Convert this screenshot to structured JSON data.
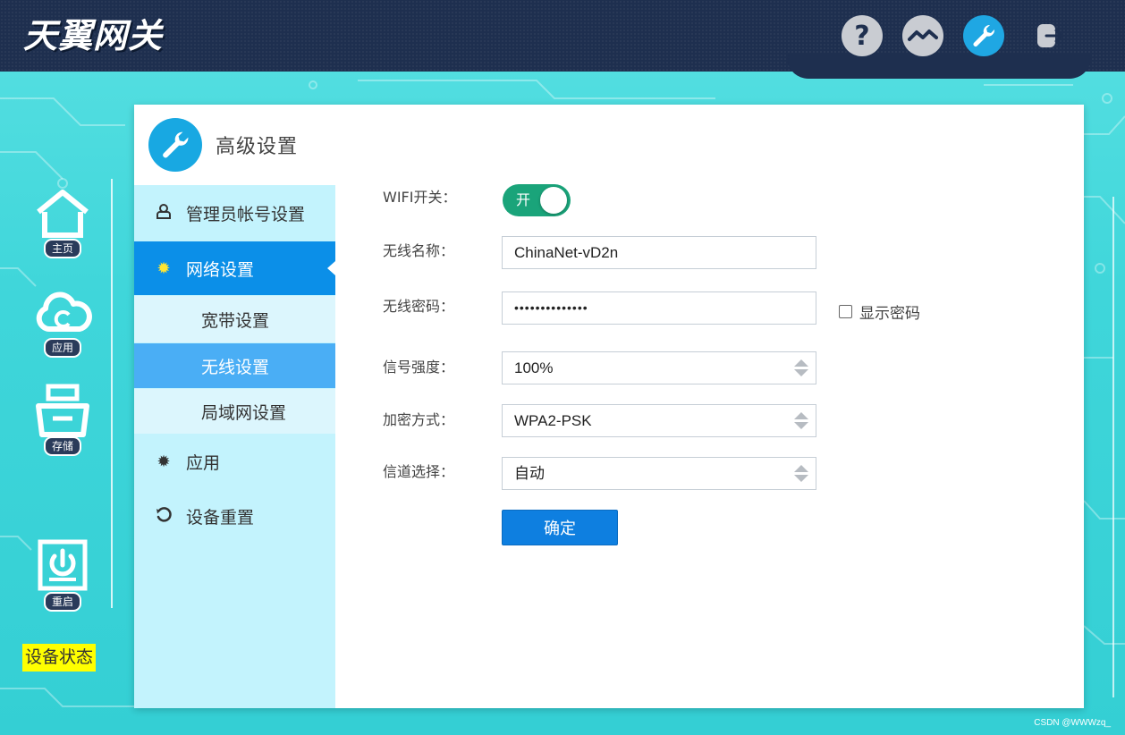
{
  "header": {
    "logo": "天翼网关",
    "icons": [
      "help-icon",
      "monitor-icon",
      "wrench-icon",
      "logout-icon"
    ]
  },
  "rail": {
    "items": [
      {
        "label": "主页",
        "icon": "home-icon"
      },
      {
        "label": "应用",
        "icon": "cloud-icon"
      },
      {
        "label": "存储",
        "icon": "storage-icon"
      },
      {
        "label": "重启",
        "icon": "power-icon"
      }
    ],
    "device_status": "设备状态"
  },
  "sidebar": {
    "title": "高级设置",
    "items": [
      {
        "label": "管理员帐号设置"
      },
      {
        "label": "网络设置",
        "active": true
      },
      {
        "label": "应用"
      },
      {
        "label": "设备重置"
      }
    ],
    "subitems": [
      {
        "label": "宽带设置"
      },
      {
        "label": "无线设置",
        "active": true
      },
      {
        "label": "局域网设置"
      }
    ]
  },
  "form": {
    "wifi_label": "WIFI开关：",
    "wifi_toggle": "开",
    "ssid_label": "无线名称：",
    "ssid_value": "ChinaNet-vD2n",
    "password_label": "无线密码：",
    "password_value": "••••••••••••••",
    "show_password": "显示密码",
    "signal_label": "信号强度：",
    "signal_value": "100%",
    "encryption_label": "加密方式：",
    "encryption_value": "WPA2-PSK",
    "channel_label": "信道选择：",
    "channel_value": "自动",
    "confirm": "确定"
  },
  "watermark": "CSDN @WWWzq_",
  "colors": {
    "topbar": "#1e2f4f",
    "accent_blue": "#0b8fe8",
    "sub_active": "#4aaef5",
    "toggle_green": "#1aa47a",
    "sidebar_bg": "#c3f3fd",
    "background_teal": "#3fd6da"
  }
}
